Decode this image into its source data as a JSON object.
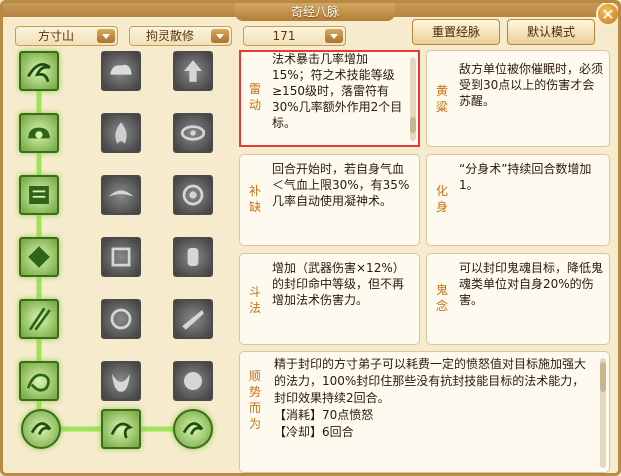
{
  "window": {
    "title": "奇经八脉"
  },
  "toolbar": {
    "school_dropdown": "方寸山",
    "mode_dropdown": "拘灵散修",
    "level_dropdown": "171",
    "reset_button": "重置经脉",
    "default_button": "默认模式"
  },
  "skills": [
    {
      "name": "雷动",
      "desc": "法术暴击几率增加15%；符之术技能等级≥150级时，落雷符有30%几率额外作用2个目标。"
    },
    {
      "name": "黄粱",
      "desc": "敌方单位被你催眠时，必须受到30点以上的伤害才会苏醒。"
    },
    {
      "name": "补缺",
      "desc": "回合开始时，若自身气血＜气血上限30%，有35%几率自动使用凝神术。"
    },
    {
      "name": "化身",
      "desc": "“分身术”持续回合数增加1。"
    },
    {
      "name": "斗法",
      "desc": "增加（武器伤害×12%）的封印命中等级，但不再增加法术伤害力。"
    },
    {
      "name": "鬼念",
      "desc": "可以封印鬼魂目标，降低鬼魂类单位对自身20%的伤害。"
    }
  ],
  "ultimate": {
    "name": "顺势而为",
    "lines": [
      "精于封印的方寸弟子可以耗费一定的愤怒值对目标施加强大的法力，100%封印住那些没有抗封技能目标的法术能力，封印效果持续2回合。",
      "【消耗】70点愤怒",
      "【冷却】6回合"
    ]
  },
  "colors": {
    "accent": "#c57214",
    "highlight": "#e53a3a",
    "active_node": "#6fa43c"
  }
}
